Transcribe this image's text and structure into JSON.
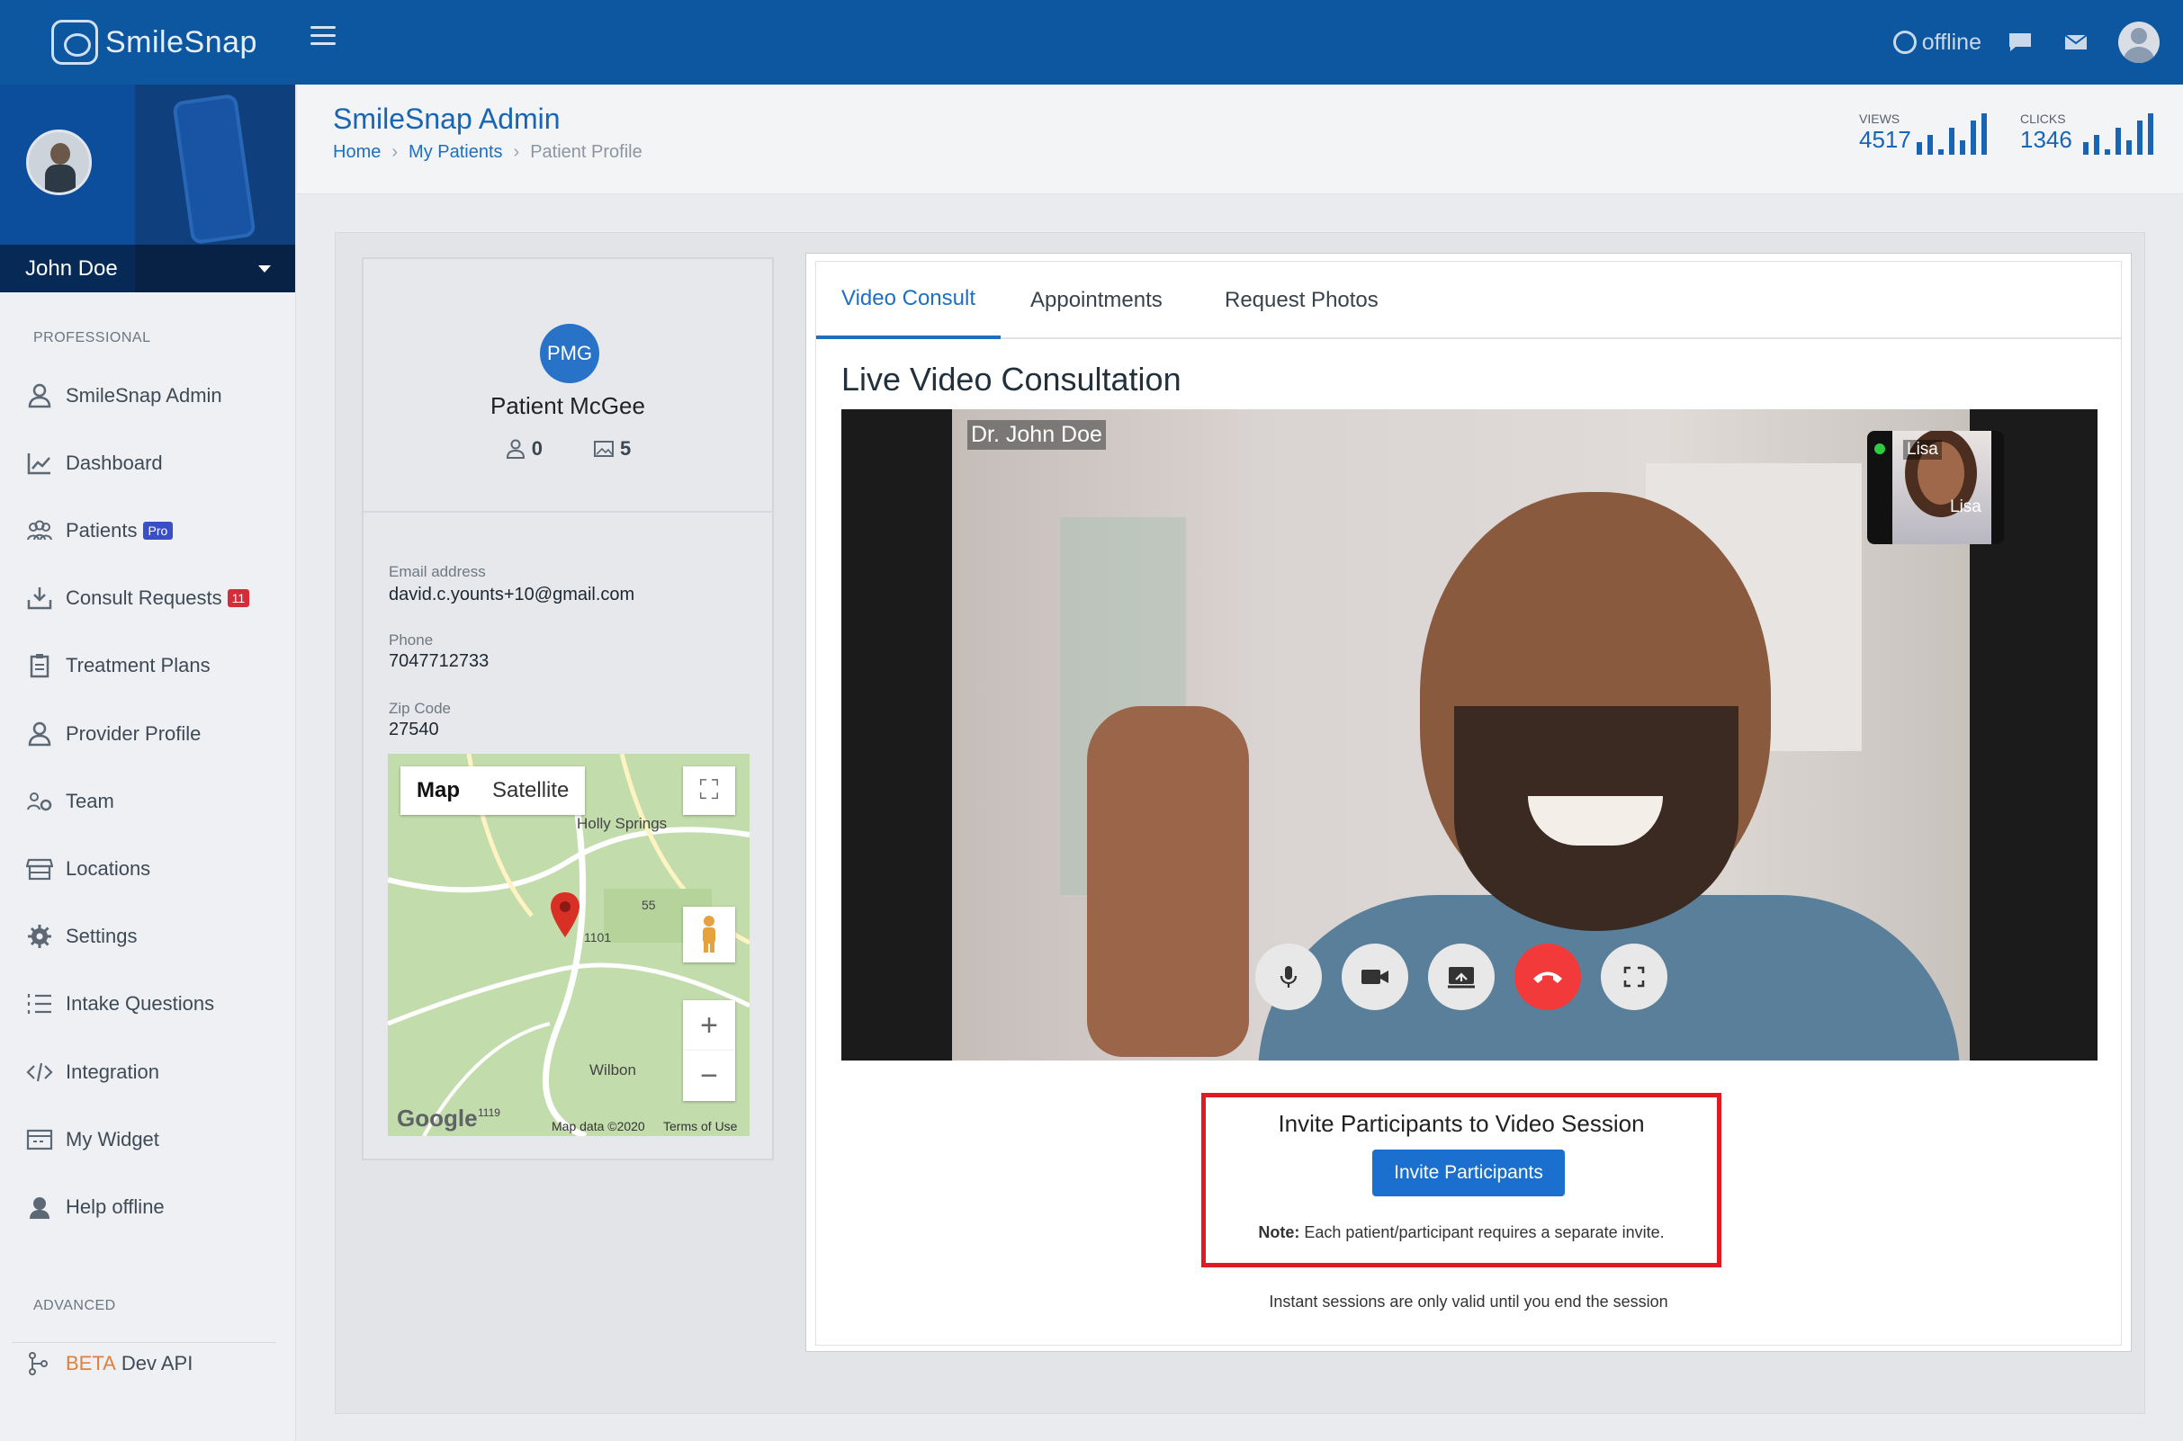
{
  "brand": {
    "name": "SmileSnap"
  },
  "topbar": {
    "status": "offline"
  },
  "user": {
    "name": "John Doe"
  },
  "sidebar": {
    "section_professional": "PROFESSIONAL",
    "items": [
      {
        "label": "SmileSnap Admin"
      },
      {
        "label": "Dashboard"
      },
      {
        "label": "Patients",
        "badge": "Pro"
      },
      {
        "label": "Consult Requests",
        "badge": "11"
      },
      {
        "label": "Treatment Plans"
      },
      {
        "label": "Provider Profile"
      },
      {
        "label": "Team"
      },
      {
        "label": "Locations"
      },
      {
        "label": "Settings"
      },
      {
        "label": "Intake Questions"
      },
      {
        "label": "Integration"
      },
      {
        "label": "My Widget"
      },
      {
        "label": "Help offline"
      }
    ],
    "section_advanced": "ADVANCED",
    "advanced_items": [
      {
        "prefix": "BETA",
        "label": "Dev API"
      }
    ]
  },
  "header": {
    "title": "SmileSnap Admin",
    "breadcrumb": [
      "Home",
      "My Patients",
      "Patient Profile"
    ],
    "stats": {
      "views_label": "VIEWS",
      "views": "4517",
      "clicks_label": "CLICKS",
      "clicks": "1346"
    }
  },
  "patient": {
    "initials": "PMG",
    "name": "Patient McGee",
    "followers": "0",
    "photos": "5",
    "email_label": "Email address",
    "email": "david.c.younts+10@gmail.com",
    "phone_label": "Phone",
    "phone": "7047712733",
    "zip_label": "Zip Code",
    "zip": "27540"
  },
  "map": {
    "tab_map": "Map",
    "tab_satellite": "Satellite",
    "place1": "Holly Springs",
    "place2": "Wilbon",
    "road1": "55",
    "road2": "1101",
    "road3": "1119",
    "logo": "Google",
    "data": "Map data ©2020",
    "terms": "Terms of Use",
    "fullscreen": "⛶",
    "zoom_in": "+",
    "zoom_out": "−"
  },
  "tabs": [
    "Video Consult",
    "Appointments",
    "Request Photos"
  ],
  "video": {
    "title": "Live Video Consultation",
    "main_participant": "Dr. John Doe",
    "pip_participant": "Lisa"
  },
  "invite": {
    "title": "Invite Participants to Video Session",
    "button": "Invite Participants",
    "note_label": "Note:",
    "note_text": " Each patient/participant requires a separate invite.",
    "instant": "Instant sessions are only valid until you end the session"
  },
  "colors": {
    "primary": "#0d57a1",
    "accent": "#1e6fc2",
    "danger": "#f23a3a",
    "highlight": "#e01b24"
  }
}
